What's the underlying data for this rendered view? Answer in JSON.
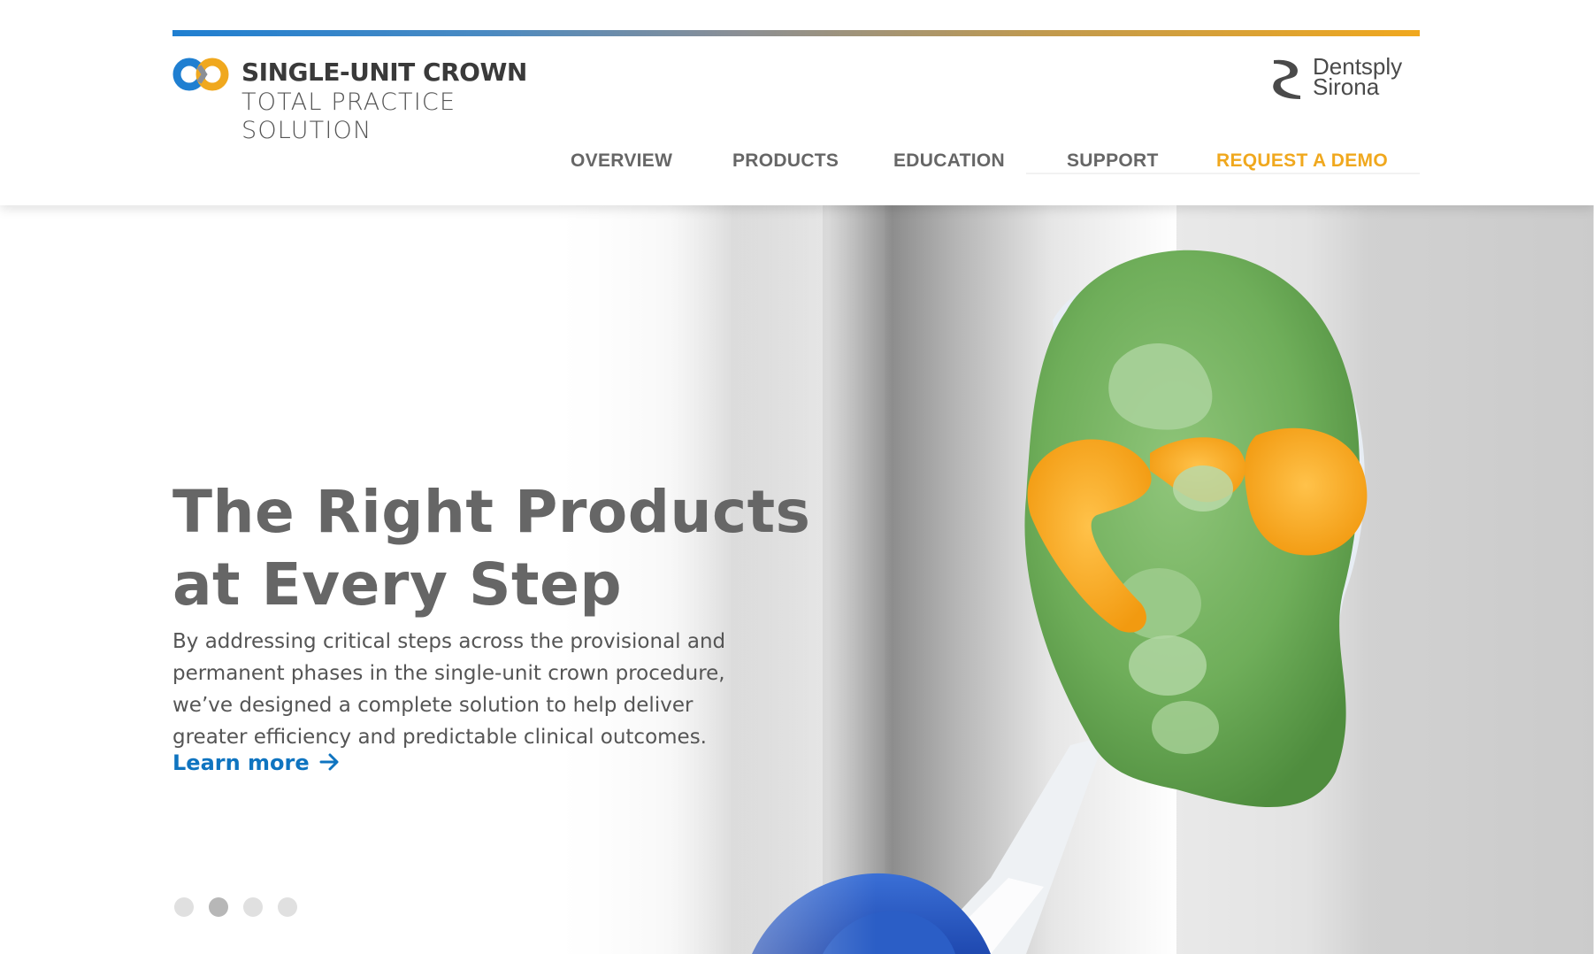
{
  "brand": {
    "line1": "SINGLE-UNIT CROWN",
    "line2": "TOTAL PRACTICE",
    "line3": "SOLUTION",
    "mark_icon": "infinity-loop-icon",
    "colors": {
      "blue": "#1f7fd1",
      "orange": "#f0a81e",
      "grey": "#8a8f96"
    }
  },
  "partner_logo": {
    "line1": "Dentsply",
    "line2": "Sirona",
    "icon": "dentsply-sirona-logo-icon"
  },
  "nav": {
    "items": [
      {
        "label": "OVERVIEW"
      },
      {
        "label": "PRODUCTS"
      },
      {
        "label": "EDUCATION"
      },
      {
        "label": "SUPPORT"
      },
      {
        "label": "REQUEST A DEMO"
      }
    ],
    "demo_color": "#f0a81e"
  },
  "hero": {
    "title": "The Right Products\nat Every Step",
    "body": "By addressing critical steps across the provisional and\npermanent phases in the single-unit crown procedure,\nwe’ve designed a complete solution to help deliver\ngreater efficiency and predictable clinical outcomes.",
    "cta_label": "Learn more",
    "cta_icon": "arrow-right-icon",
    "link_color": "#0f74c0",
    "carousel": {
      "total_slides": 4,
      "active_slide": 2
    }
  }
}
